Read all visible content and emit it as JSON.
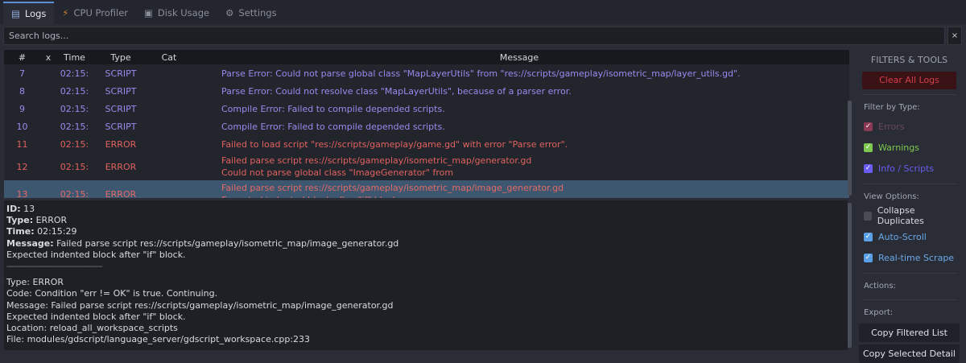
{
  "tabs": [
    {
      "label": "Logs",
      "icon": "logs-icon"
    },
    {
      "label": "CPU Profiler",
      "icon": "bolt-icon"
    },
    {
      "label": "Disk Usage",
      "icon": "disk-icon"
    },
    {
      "label": "Settings",
      "icon": "gear-icon"
    }
  ],
  "search": {
    "placeholder": "Search logs...",
    "clear": "×"
  },
  "table": {
    "headers": [
      "#",
      "x",
      "Time",
      "Type",
      "Cat",
      "Message"
    ],
    "rows": [
      {
        "id": "7",
        "time": "02:15:",
        "type": "SCRIPT",
        "cat": "",
        "msg": [
          "Parse Error: Could not parse global class \"MapLayerUtils\" from \"res://scripts/gameplay/isometric_map/layer_utils.gd\"."
        ]
      },
      {
        "id": "8",
        "time": "02:15:",
        "type": "SCRIPT",
        "cat": "",
        "msg": [
          "Parse Error: Could not resolve class \"MapLayerUtils\", because of a parser error."
        ]
      },
      {
        "id": "9",
        "time": "02:15:",
        "type": "SCRIPT",
        "cat": "",
        "msg": [
          "Compile Error: Failed to compile depended scripts."
        ]
      },
      {
        "id": "10",
        "time": "02:15:",
        "type": "SCRIPT",
        "cat": "",
        "msg": [
          "Compile Error: Failed to compile depended scripts."
        ]
      },
      {
        "id": "11",
        "time": "02:15:",
        "type": "ERROR",
        "cat": "",
        "msg": [
          "Failed to load script \"res://scripts/gameplay/game.gd\" with error \"Parse error\"."
        ]
      },
      {
        "id": "12",
        "time": "02:15:",
        "type": "ERROR",
        "cat": "",
        "msg": [
          "Failed parse script res://scripts/gameplay/isometric_map/generator.gd",
          "Could not parse global class \"ImageGenerator\" from"
        ]
      },
      {
        "id": "13",
        "time": "02:15:",
        "type": "ERROR",
        "cat": "",
        "msg": [
          "Failed parse script res://scripts/gameplay/isometric_map/image_generator.gd",
          "Expected indented block after \"if\" block."
        ]
      }
    ]
  },
  "detail": {
    "id_label": "ID:",
    "id": " 13",
    "type_label": "Type:",
    "type": " ERROR",
    "time_label": "Time:",
    "time": " 02:15:29",
    "msg_label": "Message:",
    "msg": " Failed parse script res://scripts/gameplay/isometric_map/image_generator.gd",
    "msg2": "Expected indented block after \"if\" block.",
    "separator": "----------------------------------------",
    "raw": [
      "Type: ERROR",
      "Code: Condition \"err != OK\" is true. Continuing.",
      "Message: Failed parse script res://scripts/gameplay/isometric_map/image_generator.gd",
      "Expected indented block after \"if\" block.",
      "Location: reload_all_workspace_scripts",
      "File: modules/gdscript/language_server/gdscript_workspace.cpp:233"
    ]
  },
  "side": {
    "title": "FILTERS & TOOLS",
    "clear": "Clear All Logs",
    "filter_label": "Filter by Type:",
    "filters": [
      {
        "label": "Errors",
        "checked": true,
        "color": "#c0405a"
      },
      {
        "label": "Warnings",
        "checked": true,
        "color": "#7ec850"
      },
      {
        "label": "Info / Scripts",
        "checked": true,
        "color": "#6a5cf0"
      }
    ],
    "view_label": "View Options:",
    "views": [
      {
        "label": "Collapse Duplicates",
        "checked": false
      },
      {
        "label": "Auto-Scroll",
        "checked": true
      },
      {
        "label": "Real-time Scrape",
        "checked": true
      }
    ],
    "actions_label": "Actions:",
    "export_label": "Export:",
    "copy_list": "Copy Filtered List",
    "copy_detail": "Copy Selected Detail"
  }
}
